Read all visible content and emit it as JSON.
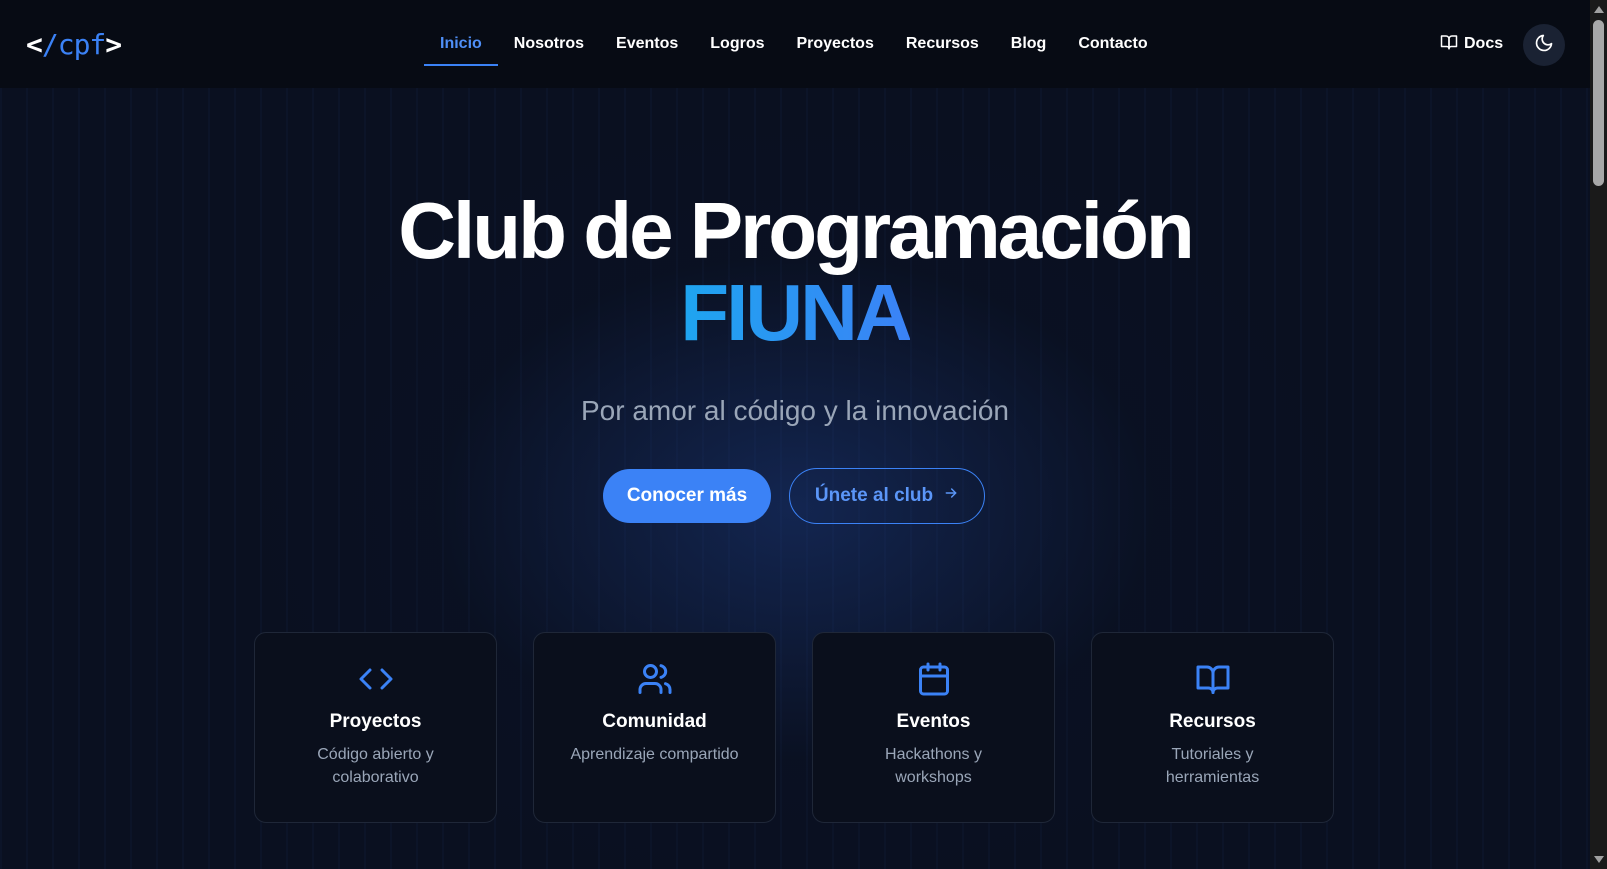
{
  "navbar": {
    "logo": {
      "open": "<",
      "slash": "/",
      "text": "cpf",
      "close": ">"
    },
    "links": [
      {
        "label": "Inicio",
        "active": true
      },
      {
        "label": "Nosotros"
      },
      {
        "label": "Eventos"
      },
      {
        "label": "Logros"
      },
      {
        "label": "Proyectos"
      },
      {
        "label": "Recursos"
      },
      {
        "label": "Blog"
      },
      {
        "label": "Contacto"
      }
    ],
    "docs_label": "Docs",
    "docs_icon": "book-open-icon",
    "theme_icon": "moon-icon"
  },
  "hero": {
    "title_line1": "Club de Programación",
    "title_line2": "FIUNA",
    "subtitle": "Por amor al código y la innovación",
    "primary_button": "Conocer más",
    "secondary_button": "Únete al club",
    "secondary_icon": "arrow-right-icon"
  },
  "features": [
    {
      "icon": "code-icon",
      "title": "Proyectos",
      "desc": "Código abierto y colaborativo"
    },
    {
      "icon": "users-icon",
      "title": "Comunidad",
      "desc": "Aprendizaje compartido"
    },
    {
      "icon": "calendar-icon",
      "title": "Eventos",
      "desc": "Hackathons y workshops"
    },
    {
      "icon": "book-open-icon",
      "title": "Recursos",
      "desc": "Tutoriales y herramientas"
    }
  ],
  "colors": {
    "accent": "#3b82f6",
    "background": "#070b14",
    "muted_text": "#9aa6b8"
  }
}
